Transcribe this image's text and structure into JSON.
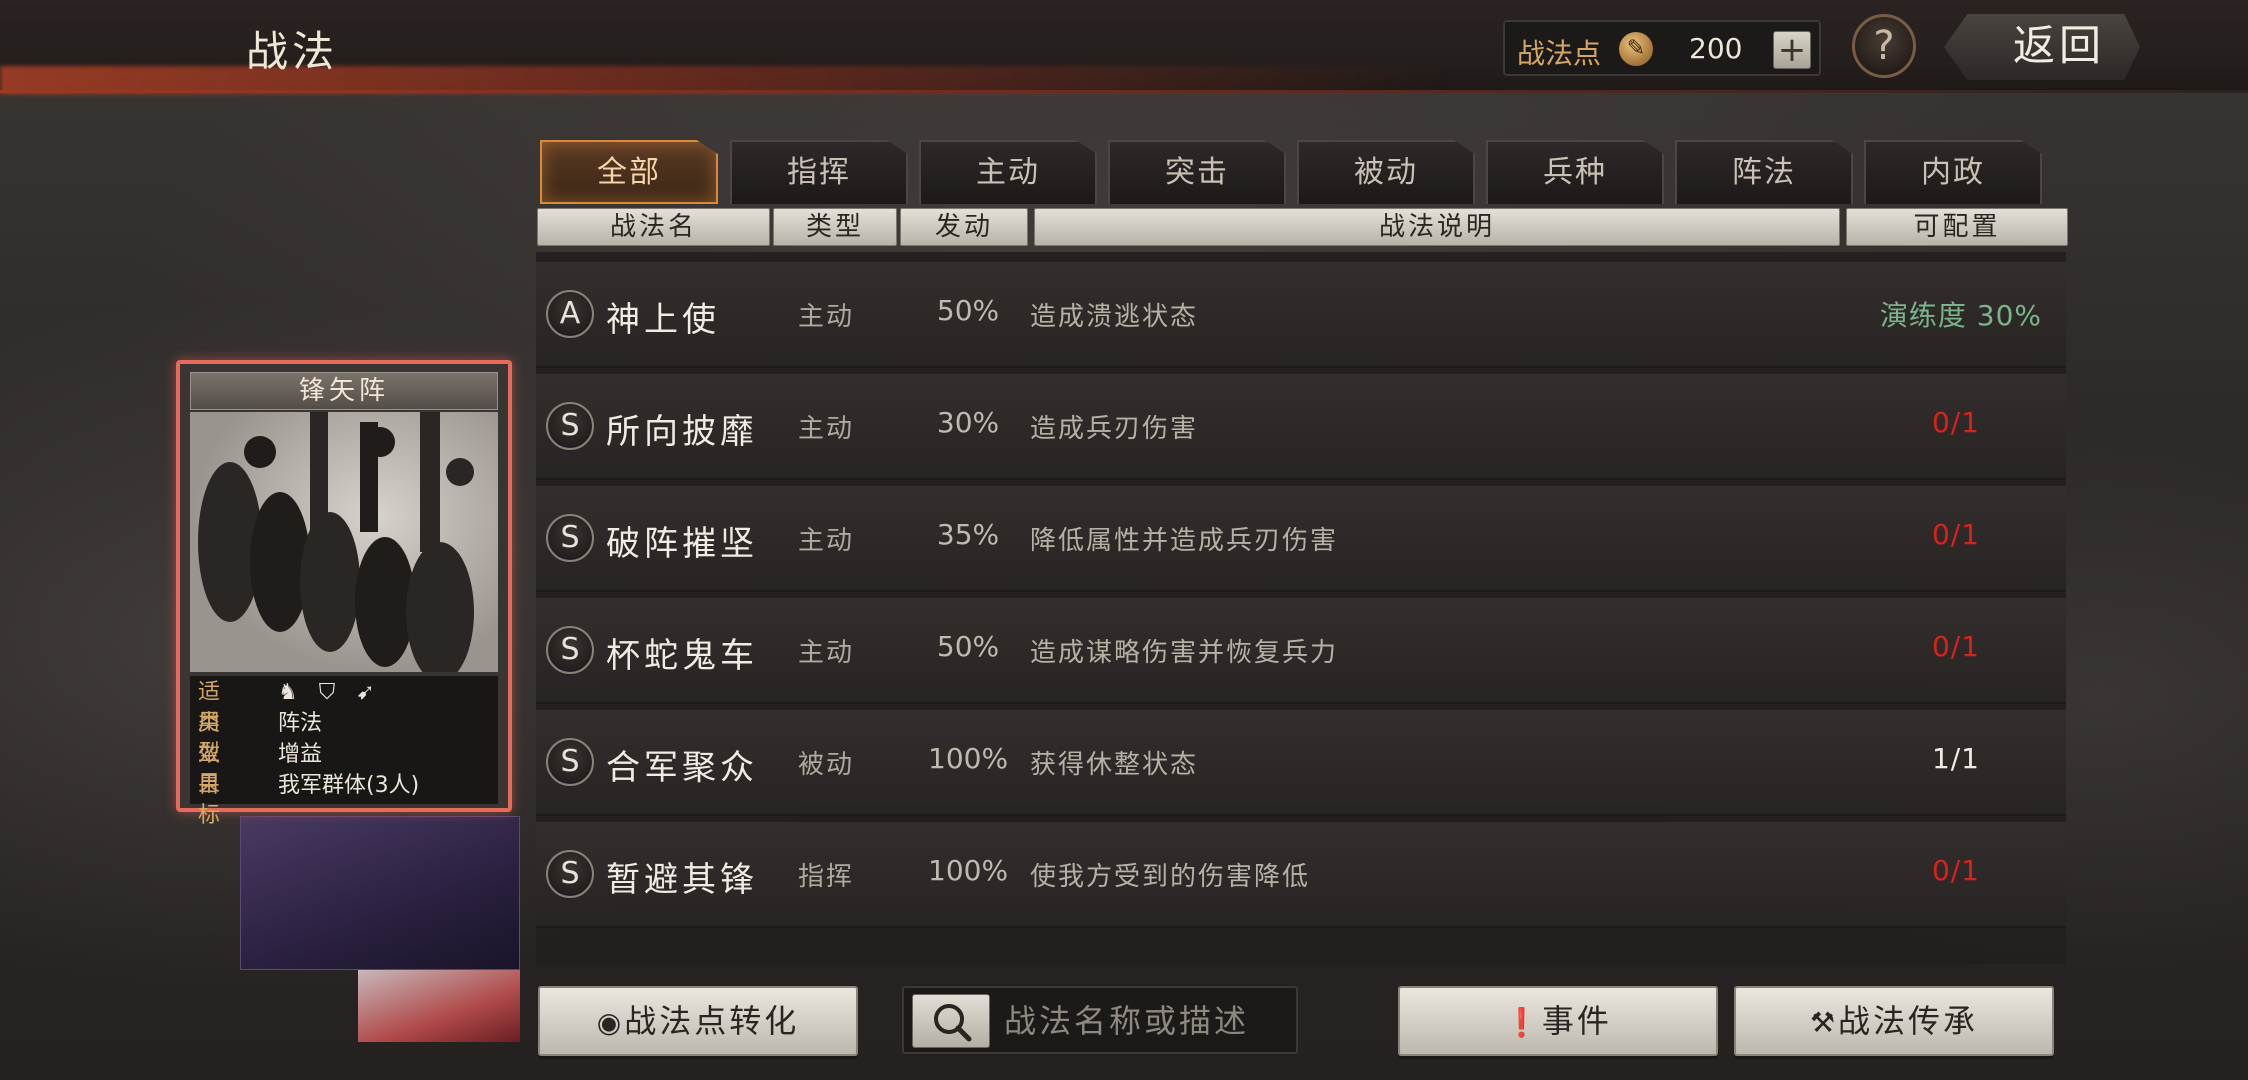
{
  "header": {
    "title": "战法",
    "points_label": "战法点",
    "points_value": "200",
    "plus_label": "+",
    "help_label": "?",
    "back_label": "返回"
  },
  "tabs": [
    {
      "label": "全部",
      "active": true
    },
    {
      "label": "指挥",
      "active": false
    },
    {
      "label": "主动",
      "active": false
    },
    {
      "label": "突击",
      "active": false
    },
    {
      "label": "被动",
      "active": false
    },
    {
      "label": "兵种",
      "active": false
    },
    {
      "label": "阵法",
      "active": false
    },
    {
      "label": "内政",
      "active": false
    }
  ],
  "columns": {
    "name": "战法名",
    "type": "类型",
    "trigger": "发动",
    "desc": "战法说明",
    "config": "可配置"
  },
  "rows": [
    {
      "grade": "A",
      "name": "神上使",
      "type": "主动",
      "rate": "50%",
      "desc": "造成溃逃状态",
      "config": "演练度 30%",
      "config_color": "green"
    },
    {
      "grade": "S",
      "name": "所向披靡",
      "type": "主动",
      "rate": "30%",
      "desc": "造成兵刃伤害",
      "config": "0/1",
      "config_color": "red"
    },
    {
      "grade": "S",
      "name": "破阵摧坚",
      "type": "主动",
      "rate": "35%",
      "desc": "降低属性并造成兵刃伤害",
      "config": "0/1",
      "config_color": "red"
    },
    {
      "grade": "S",
      "name": "杯蛇鬼车",
      "type": "主动",
      "rate": "50%",
      "desc": "造成谋略伤害并恢复兵力",
      "config": "0/1",
      "config_color": "red"
    },
    {
      "grade": "S",
      "name": "合军聚众",
      "type": "被动",
      "rate": "100%",
      "desc": "获得休整状态",
      "config": "1/1",
      "config_color": "white"
    },
    {
      "grade": "S",
      "name": "暂避其锋",
      "type": "指挥",
      "rate": "100%",
      "desc": "使我方受到的伤害降低",
      "config": "0/1",
      "config_color": "red"
    }
  ],
  "card": {
    "title": "锋矢阵",
    "info": [
      {
        "key": "适用",
        "value": ""
      },
      {
        "key": "类型",
        "value": "阵法"
      },
      {
        "key": "效果",
        "value": "增益"
      },
      {
        "key": "目标",
        "value": "我军群体(3人)"
      }
    ],
    "troop_icons": [
      "cavalry-icon",
      "shield-icon",
      "bow-icon"
    ]
  },
  "bottom": {
    "convert_label": "战法点转化",
    "search_placeholder": "战法名称或描述",
    "event_label": "事件",
    "inherit_label": "战法传承"
  },
  "colors": {
    "accent_orange": "#d88a3a",
    "red": "#d8221c",
    "green": "#7ab48a",
    "gold": "#d4a864"
  }
}
